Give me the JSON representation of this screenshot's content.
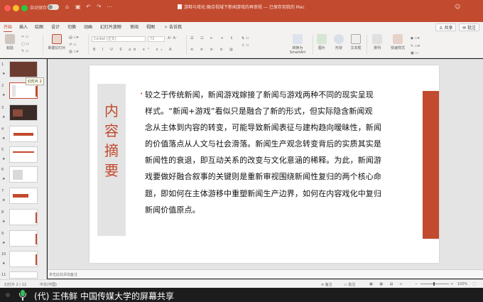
{
  "titlebar": {
    "autosave_label": "自动保存",
    "document_title": "游释与戏化:融合视域下新闻游戏的再审视 — 已保存到我的 Mac",
    "share_label": "共享",
    "comment_label": "批注"
  },
  "ribbon": {
    "tabs": [
      "开始",
      "插入",
      "绘图",
      "设计",
      "切换",
      "动画",
      "幻灯片放映",
      "审阅",
      "视图",
      "告诉我"
    ],
    "active_tab": "开始",
    "paste_label": "粘贴",
    "new_slide_label": "新建幻灯片",
    "font_name": "Corbel (正文)",
    "font_size": "72",
    "convert_label": "转换为 SmartArt",
    "picture_label": "图片",
    "shape_label": "形状",
    "textbox_label": "文本框",
    "arrange_label": "排列",
    "quick_styles_label": "快速样式"
  },
  "thumbnails": {
    "numbers": [
      "1",
      "2",
      "3",
      "4",
      "5",
      "6",
      "7",
      "8",
      "9",
      "10",
      "11"
    ],
    "tooltip": "幻灯片 2"
  },
  "slide": {
    "title": [
      "内",
      "容",
      "摘",
      "要"
    ],
    "bullet": "•",
    "body_lines": [
      "较之于传统新闻，新闻游戏嫁接了新闻与游戏两种不同的现实呈现",
      "样式。“新闻+游戏”看似只是融合了新的形式，但实际隐含新闻观",
      "念从主体到内容的转变，可能导致新闻表征与建构趋向暧昧性，新闻",
      "的价值落点从人文与社会滑落。新闻生产观念转变背后的实质其实是",
      "新闻性的衰退，即互动关系的改变与文化意涵的稀释。为此，新闻游",
      "戏要做好融合叙事的关键则是重新审视围绕新闻性复归的两个核心命",
      "题，即如何在主体游移中重塑新闻生产边界，如何在内容戏化中复归",
      "新闻价值原点。"
    ]
  },
  "notes_placeholder": "单击此处添加备注",
  "statusbar": {
    "slide_counter": "幻灯片 2 / 12",
    "language": "中文(中国)",
    "notes_label": "备注",
    "comments_label": "批注",
    "zoom": "100%"
  },
  "share_banner": {
    "text": "(代) 王伟鲜 中国传媒大学的屏幕共享"
  },
  "colors": {
    "accent": "#c24a2e",
    "side_panel": "#e3e3e3"
  }
}
